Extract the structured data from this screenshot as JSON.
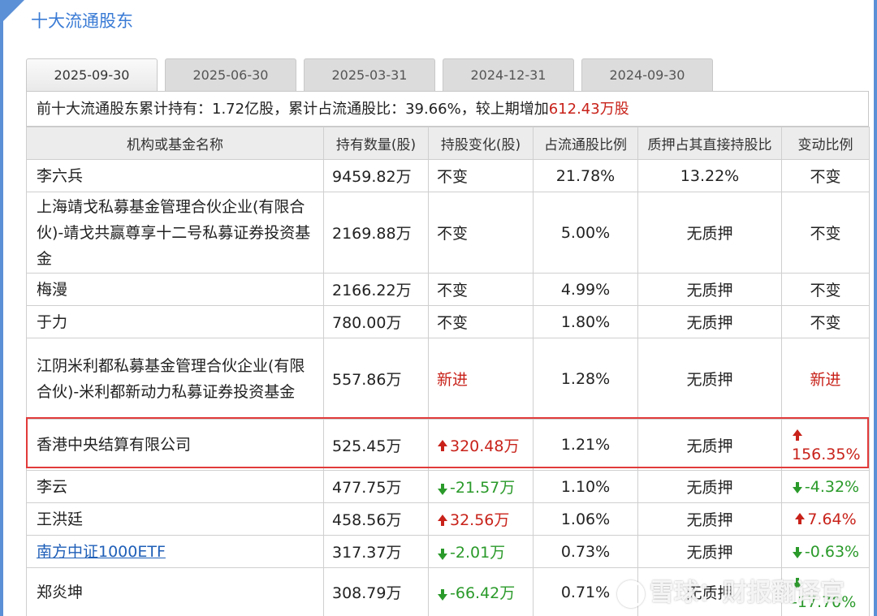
{
  "title": "十大流通股东",
  "tabs": [
    "2025-09-30",
    "2025-06-30",
    "2025-03-31",
    "2024-12-31",
    "2024-09-30"
  ],
  "active_tab": "2025-09-30",
  "summary": {
    "prefix": "前十大流通股东累计持有：",
    "holding": "1.72亿股",
    "sep1": "，累计占流通股比：",
    "ratio": "39.66%",
    "sep2": "，较上期增加",
    "increase": "612.43万股"
  },
  "columns": [
    "机构或基金名称",
    "持有数量(股)",
    "持股变化(股)",
    "占流通股比例",
    "质押占其直接持股比",
    "变动比例"
  ],
  "rows": [
    {
      "name": "李六兵",
      "qty": "9459.82万",
      "change": "不变",
      "ratio": "21.78%",
      "pledge": "13.22%",
      "pct": "不变"
    },
    {
      "name": "上海靖戈私募基金管理合伙企业(有限合伙)-靖戈共赢尊享十二号私募证券投资基金",
      "qty": "2169.88万",
      "change": "不变",
      "ratio": "5.00%",
      "pledge": "无质押",
      "pct": "不变"
    },
    {
      "name": "梅漫",
      "qty": "2166.22万",
      "change": "不变",
      "ratio": "4.99%",
      "pledge": "无质押",
      "pct": "不变"
    },
    {
      "name": "于力",
      "qty": "780.00万",
      "change": "不变",
      "ratio": "1.80%",
      "pledge": "无质押",
      "pct": "不变"
    },
    {
      "name": "江阴米利都私募基金管理合伙企业(有限合伙)-米利都新动力私募证券投资基金",
      "qty": "557.86万",
      "change": "新进",
      "ratio": "1.28%",
      "pledge": "无质押",
      "pct": "新进"
    },
    {
      "name": "香港中央结算有限公司",
      "qty": "525.45万",
      "change": "320.48万",
      "ratio": "1.21%",
      "pledge": "无质押",
      "pct": "156.35%"
    },
    {
      "name": "李云",
      "qty": "477.75万",
      "change": "-21.57万",
      "ratio": "1.10%",
      "pledge": "无质押",
      "pct": "-4.32%"
    },
    {
      "name": "王洪廷",
      "qty": "458.56万",
      "change": "32.56万",
      "ratio": "1.06%",
      "pledge": "无质押",
      "pct": "7.64%"
    },
    {
      "name": "南方中证1000ETF",
      "qty": "317.37万",
      "change": "-2.01万",
      "ratio": "0.73%",
      "pledge": "无质押",
      "pct": "-0.63%"
    },
    {
      "name": "郑炎坤",
      "qty": "308.79万",
      "change": "-66.42万",
      "ratio": "0.71%",
      "pledge": "无质押",
      "pct": "-17.70%"
    }
  ],
  "watermark": "雪球：财报翻译官",
  "colors": {
    "accent": "#3a7bd5",
    "up": "#c8221a",
    "down": "#2a9a2a",
    "highlight": "#e23b3b"
  }
}
